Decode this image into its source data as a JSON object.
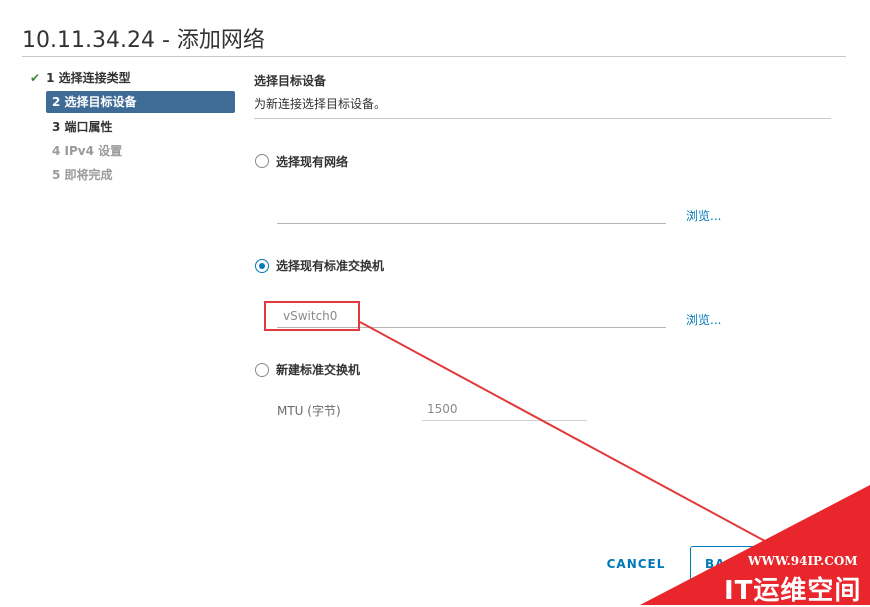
{
  "dialog": {
    "title": "10.11.34.24 - 添加网络"
  },
  "steps": [
    {
      "label": "1 选择连接类型",
      "status": "done"
    },
    {
      "label": "2 选择目标设备",
      "status": "active"
    },
    {
      "label": "3 端口属性",
      "status": "enabled"
    },
    {
      "label": "4 IPv4 设置",
      "status": "disabled"
    },
    {
      "label": "5 即将完成",
      "status": "disabled"
    }
  ],
  "section": {
    "title": "选择目标设备",
    "description": "为新连接选择目标设备。"
  },
  "options": {
    "existing_network": {
      "label": "选择现有网络",
      "selected": false,
      "value": "",
      "browse": "浏览..."
    },
    "existing_switch": {
      "label": "选择现有标准交换机",
      "selected": true,
      "value": "vSwitch0",
      "browse": "浏览..."
    },
    "new_switch": {
      "label": "新建标准交换机",
      "selected": false,
      "mtu_label": "MTU (字节)",
      "mtu_value": "1500"
    }
  },
  "footer": {
    "cancel_label": "CANCEL",
    "back_label": "BA"
  },
  "watermark": {
    "url": "WWW.94IP.COM",
    "name": "IT运维空间"
  },
  "colors": {
    "accent": "#0079b8",
    "active_step": "#3f6b97",
    "annotation_red": "#e03a3a"
  }
}
